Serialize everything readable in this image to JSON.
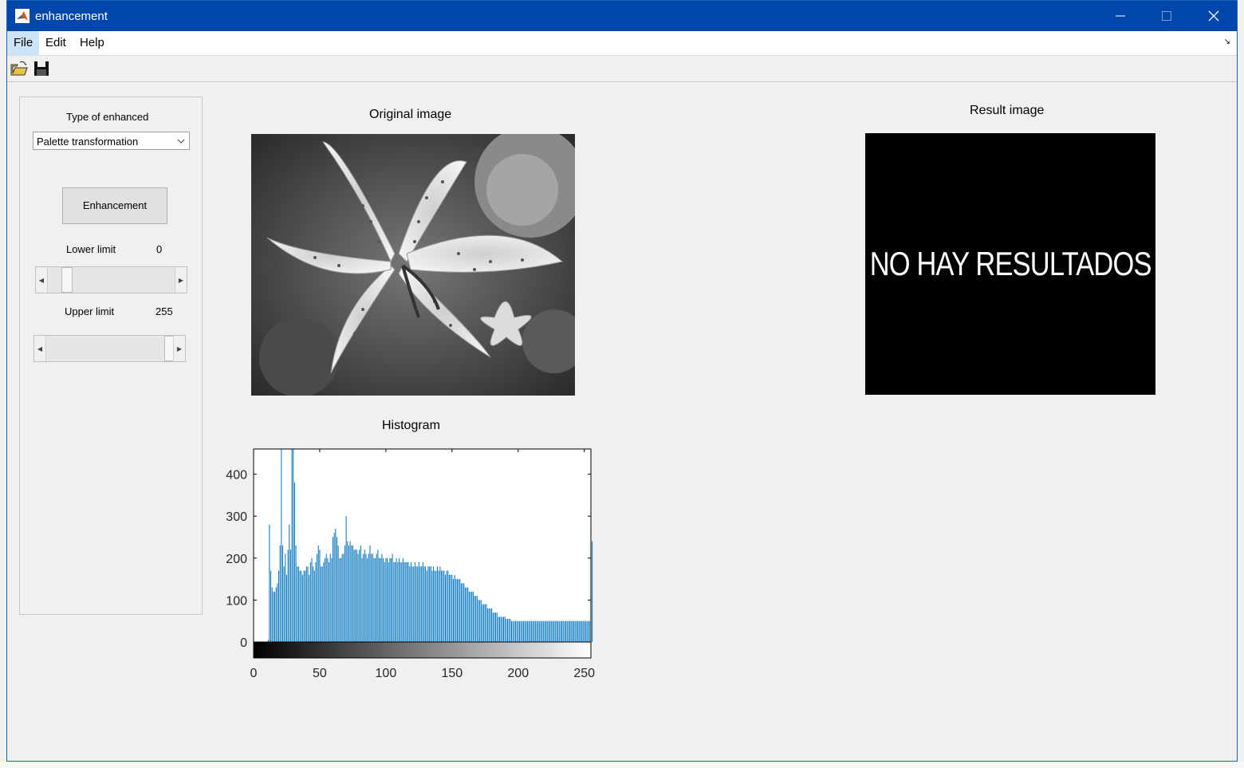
{
  "window": {
    "title": "enhancement",
    "menu": [
      "File",
      "Edit",
      "Help"
    ],
    "toolbar": [
      "open-icon",
      "save-icon"
    ]
  },
  "panel": {
    "type_label": "Type of enhanced",
    "type_value": "Palette transformation",
    "enhance_button": "Enhancement",
    "lower_label": "Lower limit",
    "lower_value": "0",
    "upper_label": "Upper limit",
    "upper_value": "255",
    "lower_slider_level": 0.12,
    "upper_slider_level": 1.0
  },
  "original": {
    "title": "Original image"
  },
  "result": {
    "title": "Result image",
    "message": "NO HAY RESULTADOS"
  },
  "histogram": {
    "title": "Histogram"
  },
  "chart_data": {
    "type": "bar",
    "title": "Histogram",
    "xlim": [
      0,
      255
    ],
    "ylim": [
      0,
      460
    ],
    "xticks": [
      0,
      50,
      100,
      150,
      200,
      250
    ],
    "yticks": [
      0,
      100,
      200,
      300,
      400
    ],
    "colorbar": "gray",
    "series": [
      {
        "values": [
          0,
          0,
          0,
          0,
          0,
          0,
          0,
          0,
          0,
          0,
          0,
          5,
          280,
          170,
          130,
          120,
          120,
          130,
          140,
          170,
          230,
          470,
          230,
          180,
          210,
          160,
          220,
          280,
          220,
          470,
          470,
          380,
          230,
          180,
          180,
          170,
          170,
          160,
          170,
          170,
          180,
          180,
          160,
          190,
          200,
          180,
          170,
          190,
          210,
          230,
          220,
          180,
          180,
          190,
          200,
          210,
          200,
          190,
          210,
          200,
          250,
          260,
          270,
          250,
          230,
          200,
          200,
          210,
          210,
          230,
          300,
          240,
          230,
          240,
          230,
          230,
          220,
          220,
          220,
          210,
          220,
          230,
          200,
          210,
          220,
          210,
          200,
          210,
          230,
          210,
          210,
          200,
          200,
          210,
          220,
          200,
          200,
          210,
          200,
          190,
          200,
          200,
          190,
          200,
          200,
          210,
          190,
          190,
          200,
          190,
          200,
          190,
          190,
          200,
          190,
          190,
          190,
          190,
          180,
          190,
          180,
          180,
          190,
          180,
          180,
          190,
          180,
          180,
          190,
          180,
          180,
          170,
          180,
          180,
          180,
          170,
          180,
          170,
          170,
          180,
          170,
          180,
          170,
          170,
          170,
          160,
          170,
          170,
          160,
          160,
          160,
          150,
          160,
          150,
          150,
          150,
          150,
          140,
          140,
          140,
          130,
          130,
          130,
          120,
          120,
          120,
          120,
          110,
          110,
          110,
          100,
          100,
          100,
          90,
          90,
          90,
          90,
          80,
          80,
          80,
          80,
          70,
          70,
          70,
          70,
          60,
          60,
          60,
          60,
          60,
          60,
          55,
          55,
          55,
          55,
          50,
          50,
          50,
          50,
          50,
          50,
          50,
          50,
          50,
          50,
          50,
          50,
          50,
          50,
          50,
          50,
          50,
          50,
          50,
          50,
          50,
          50,
          50,
          50,
          50,
          50,
          50,
          50,
          50,
          50,
          50,
          50,
          50,
          50,
          50,
          50,
          50,
          50,
          50,
          50,
          50,
          50,
          50,
          50,
          50,
          50,
          50,
          50,
          50,
          50,
          50,
          50,
          50,
          50,
          50,
          50,
          50,
          50,
          50,
          50,
          80,
          240
        ]
      }
    ]
  },
  "colors": {
    "titlebar": "#0047ab",
    "bar": "#0072bd",
    "window_bg": "#f0f0f0"
  }
}
